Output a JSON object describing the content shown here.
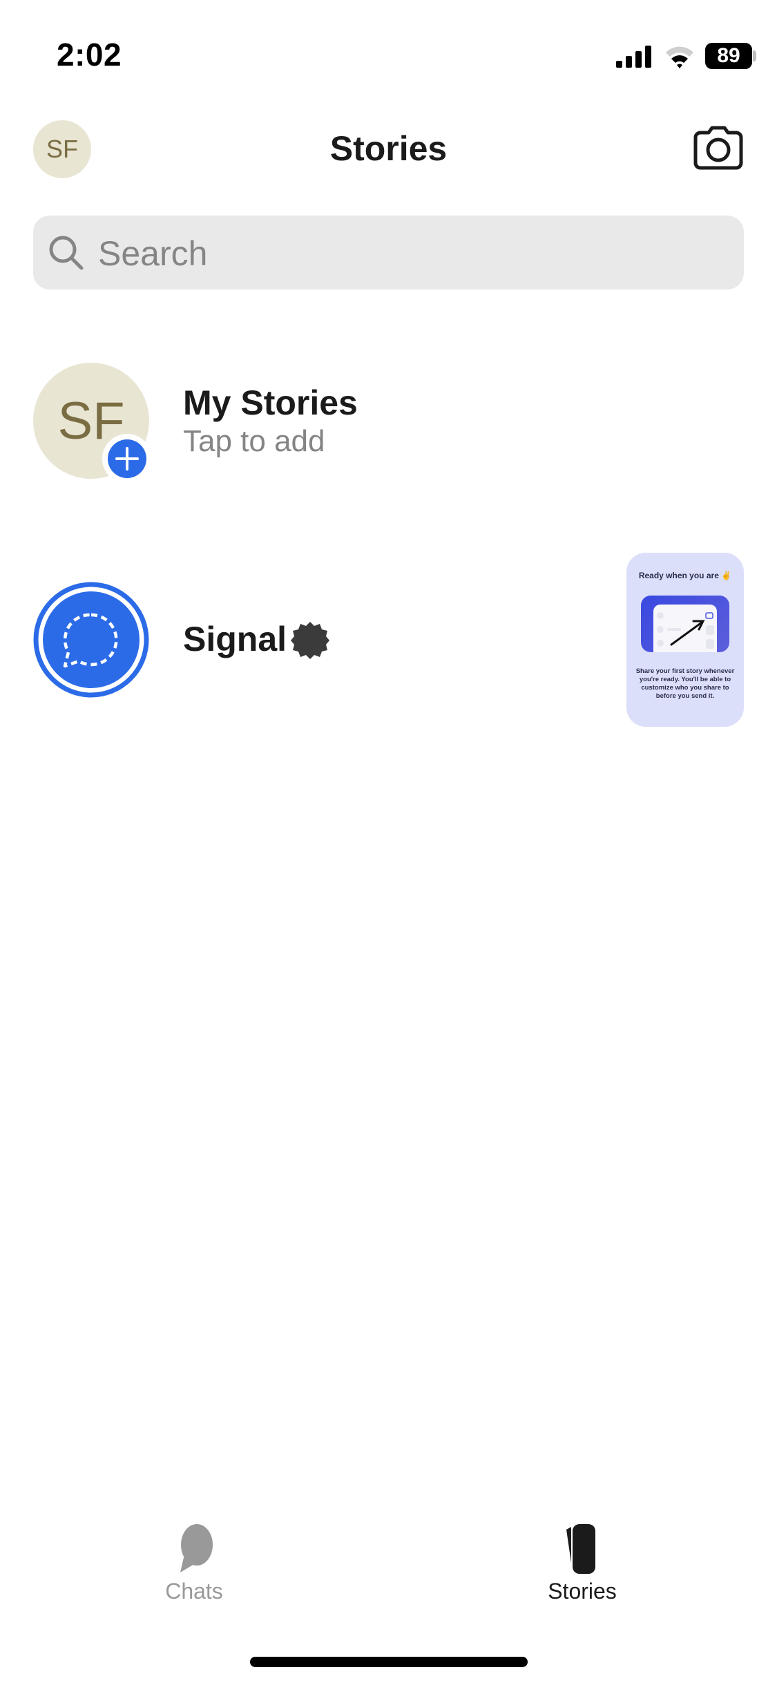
{
  "status_bar": {
    "time": "2:02",
    "battery": "89",
    "icons": [
      "cellular-signal-icon",
      "wifi-icon",
      "battery-icon"
    ]
  },
  "header": {
    "avatar_initials": "SF",
    "title": "Stories",
    "camera_icon": "camera-icon"
  },
  "search": {
    "placeholder": "Search",
    "value": ""
  },
  "stories": [
    {
      "name": "My Stories",
      "subtitle": "Tap to add",
      "avatar_initials": "SF",
      "badge_icon": "plus-icon"
    },
    {
      "name": "Signal",
      "badge_icon": "verified-badge-icon",
      "thumbnail": {
        "title": "Ready when you are ✌",
        "body": "Share your first story whenever you're ready. You'll be able to customize who you share to before you send it."
      }
    }
  ],
  "tab_bar": {
    "tabs": [
      {
        "label": "Chats",
        "icon": "chat-bubble-icon",
        "active": false
      },
      {
        "label": "Stories",
        "icon": "stories-icon",
        "active": true
      }
    ]
  },
  "colors": {
    "accent": "#2c6be8",
    "avatar_bg": "#e9e5d3",
    "avatar_text": "#7a6d43",
    "inactive_tab": "#999999",
    "active_tab": "#1b1b1b"
  }
}
